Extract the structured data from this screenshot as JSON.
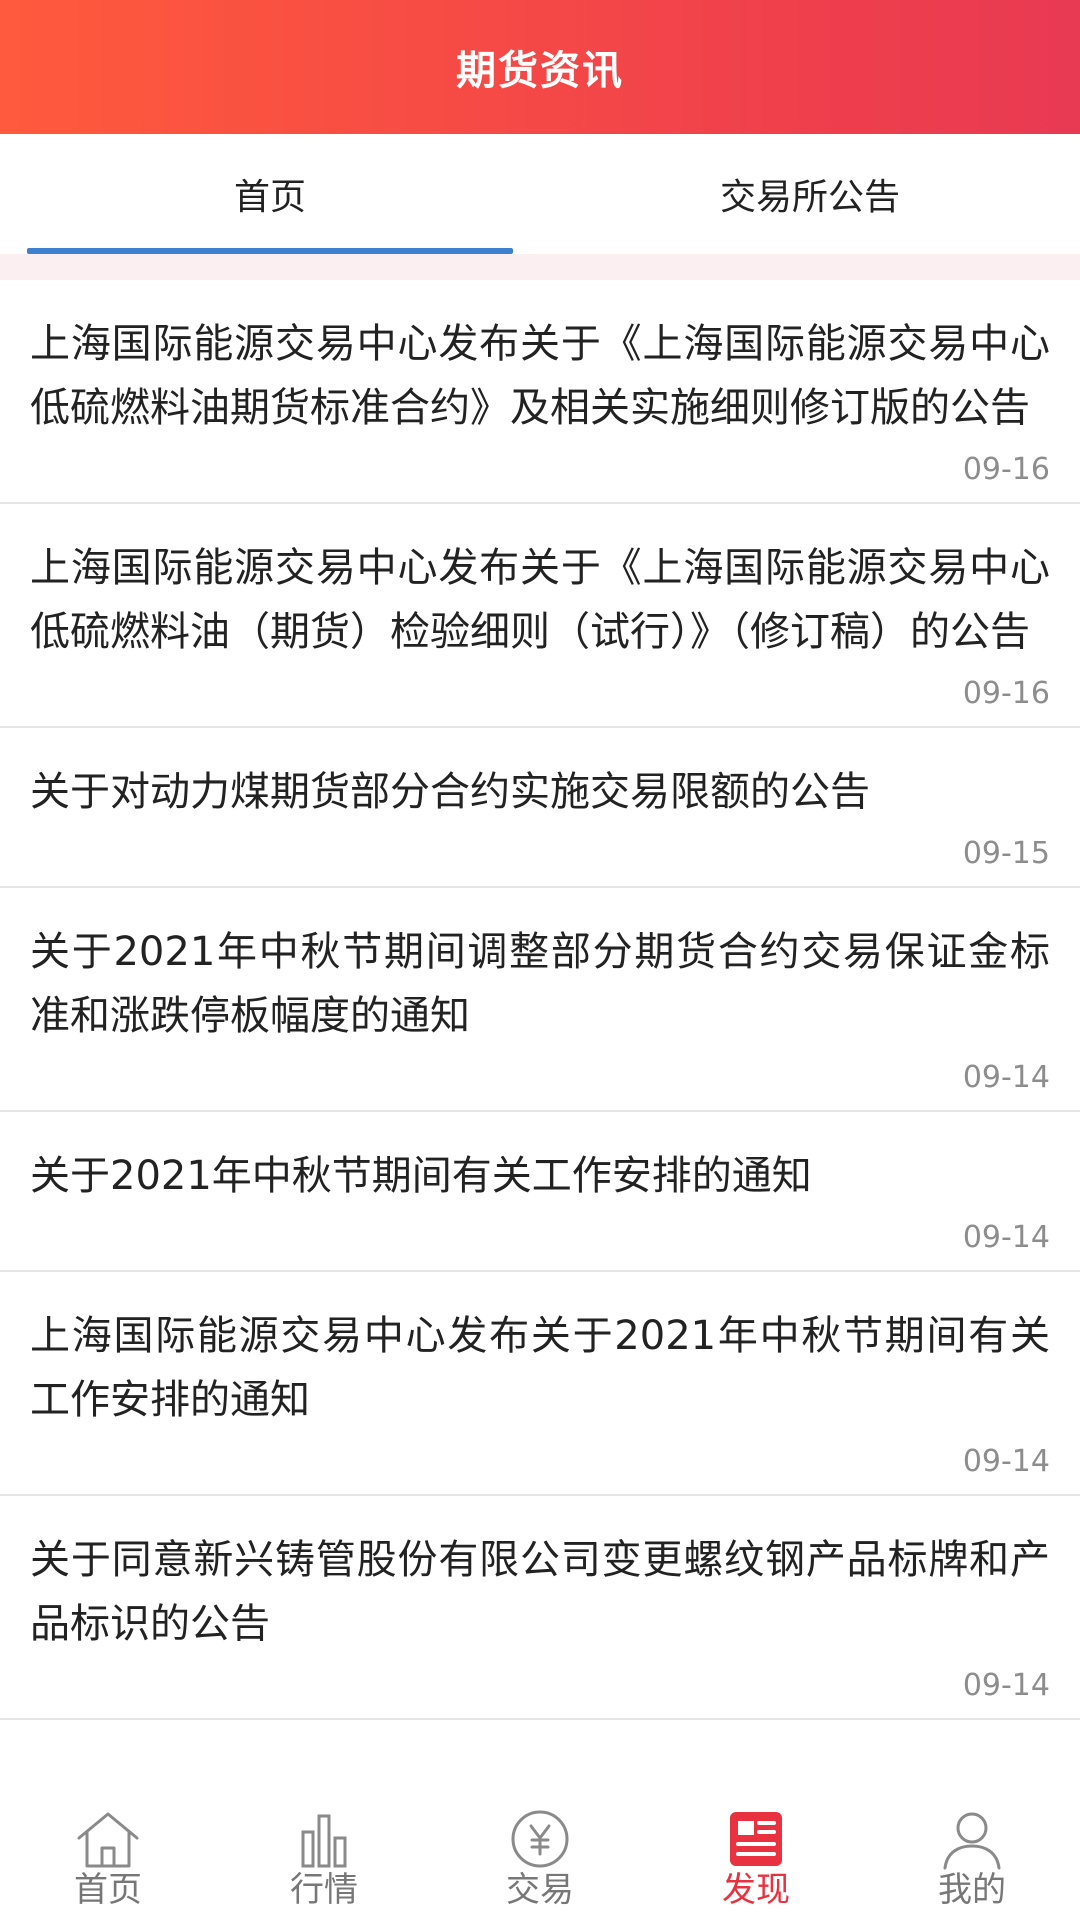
{
  "header": {
    "title": "期货资讯"
  },
  "tabs": [
    {
      "label": "首页",
      "active": true
    },
    {
      "label": "交易所公告",
      "active": false
    }
  ],
  "news": [
    {
      "title": "上海国际能源交易中心发布关于《上海国际能源交易中心低硫燃料油期货标准合约》及相关实施细则修订版的公告",
      "date": "09-16"
    },
    {
      "title": "上海国际能源交易中心发布关于《上海国际能源交易中心低硫燃料油（期货）检验细则（试行）》（修订稿）的公告",
      "date": "09-16"
    },
    {
      "title": "关于对动力煤期货部分合约实施交易限额的公告",
      "date": "09-15"
    },
    {
      "title": "关于2021年中秋节期间调整部分期货合约交易保证金标准和涨跌停板幅度的通知",
      "date": "09-14"
    },
    {
      "title": "关于2021年中秋节期间有关工作安排的通知",
      "date": "09-14"
    },
    {
      "title": "上海国际能源交易中心发布关于2021年中秋节期间有关工作安排的通知",
      "date": "09-14"
    },
    {
      "title": "关于同意新兴铸管股份有限公司变更螺纹钢产品标牌和产品标识的公告",
      "date": "09-14"
    }
  ],
  "bottom_nav": [
    {
      "label": "首页",
      "icon": "home-icon",
      "active": false
    },
    {
      "label": "行情",
      "icon": "bar-chart-icon",
      "active": false
    },
    {
      "label": "交易",
      "icon": "yen-coin-icon",
      "active": false
    },
    {
      "label": "发现",
      "icon": "news-icon",
      "active": true
    },
    {
      "label": "我的",
      "icon": "user-icon",
      "active": false
    }
  ],
  "colors": {
    "header_start": "#ff5a3d",
    "header_end": "#e83a52",
    "tab_indicator": "#3f7fd0",
    "active_nav": "#e8323f",
    "inactive_nav": "#777777"
  }
}
